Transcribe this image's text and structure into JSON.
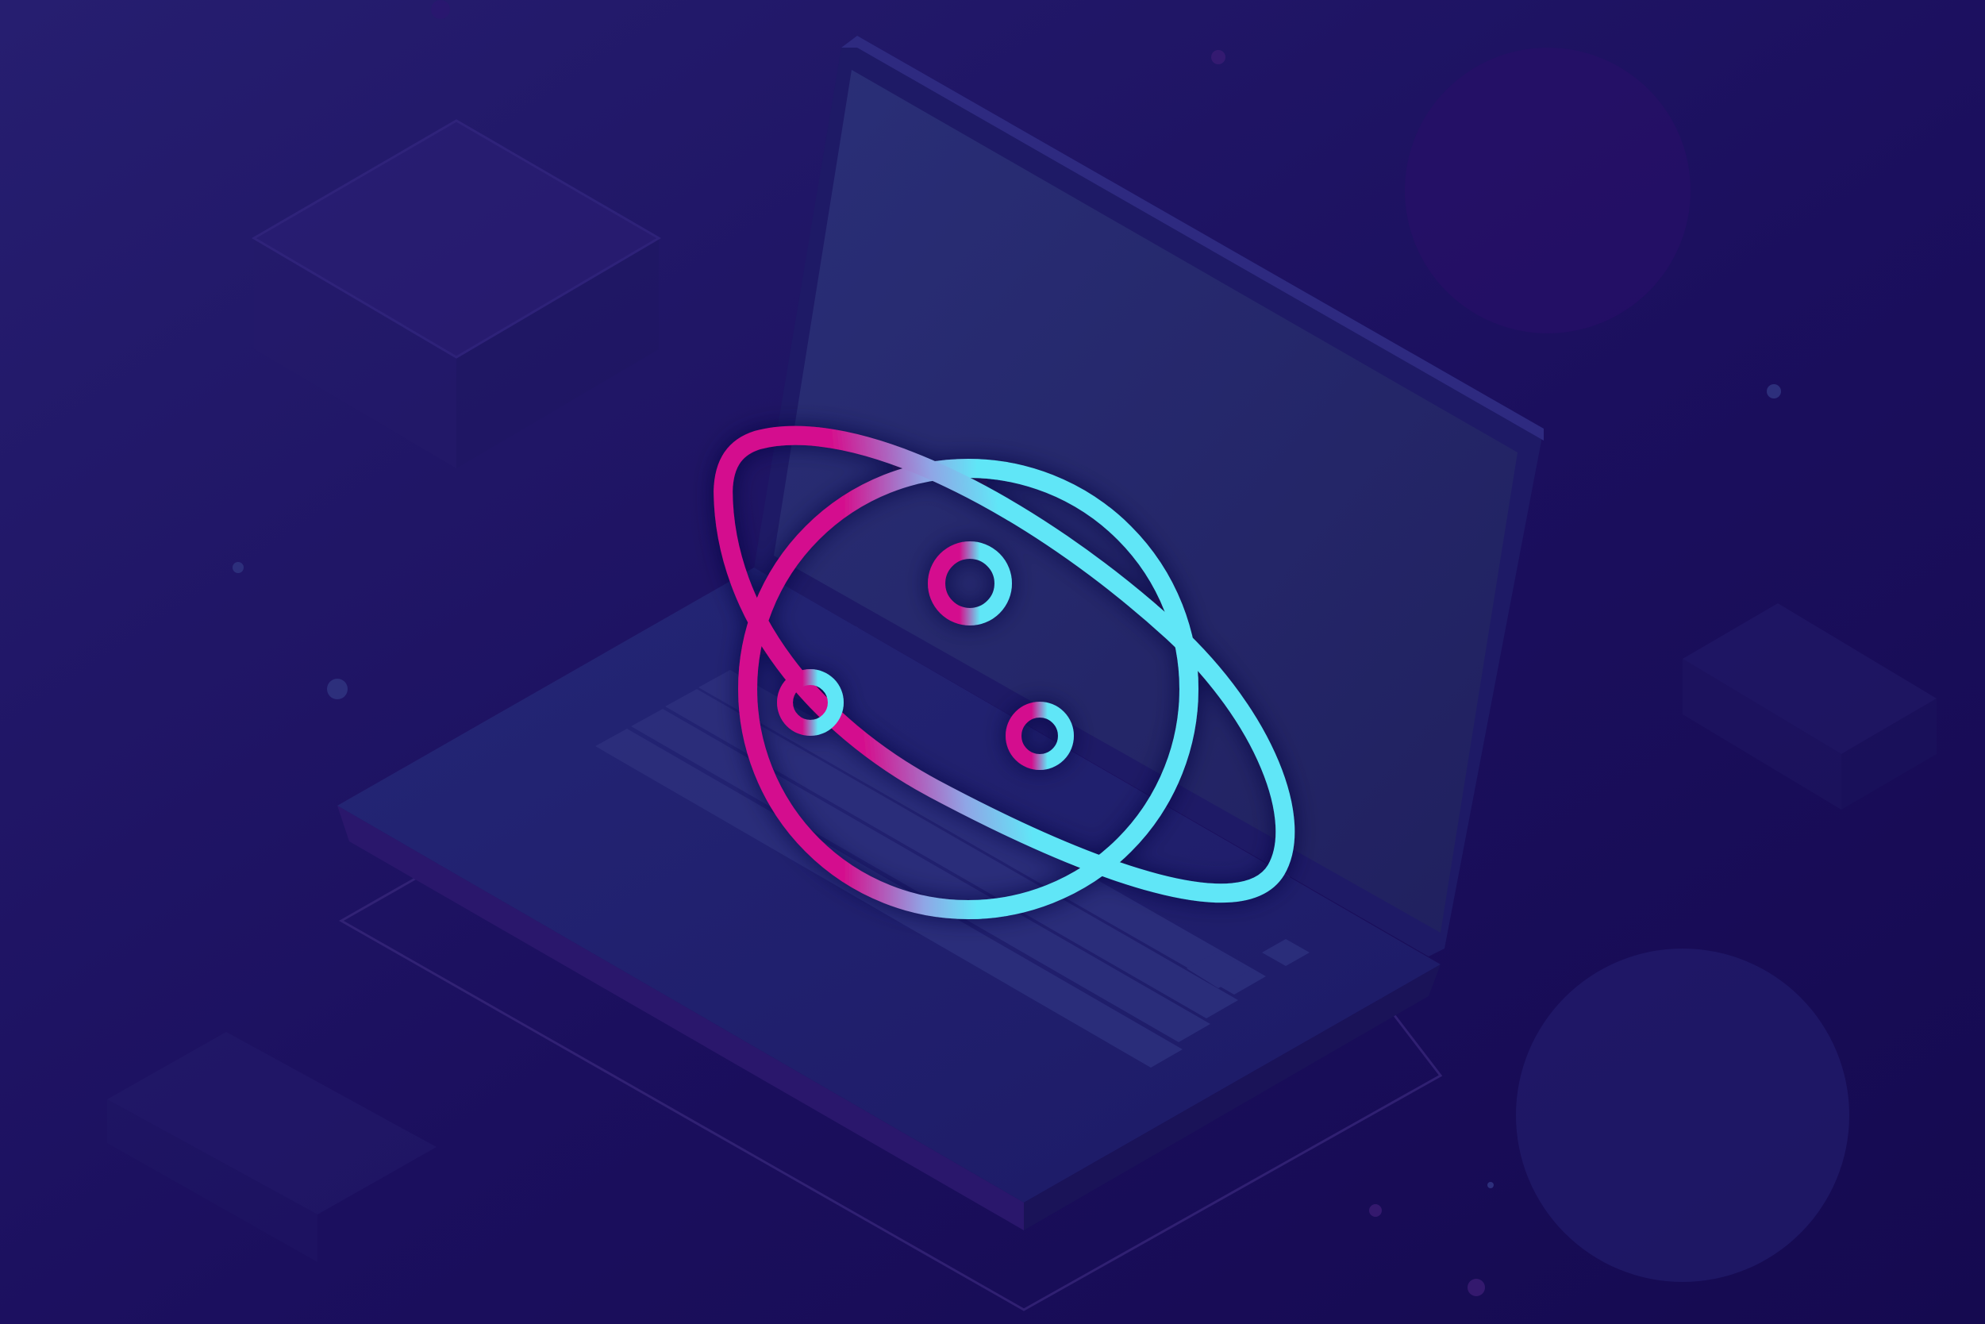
{
  "colors": {
    "background_top": "#241c6e",
    "background_bottom": "#160b52",
    "laptop_screen": "#262a72",
    "laptop_body": "#221c6a",
    "accent_magenta": "#d4118e",
    "accent_cyan": "#61e6f7"
  },
  "icons": {
    "logo": "planet-with-ring-icon",
    "laptop": "laptop-illustration",
    "decor_boxes": "isometric-box-icon"
  }
}
